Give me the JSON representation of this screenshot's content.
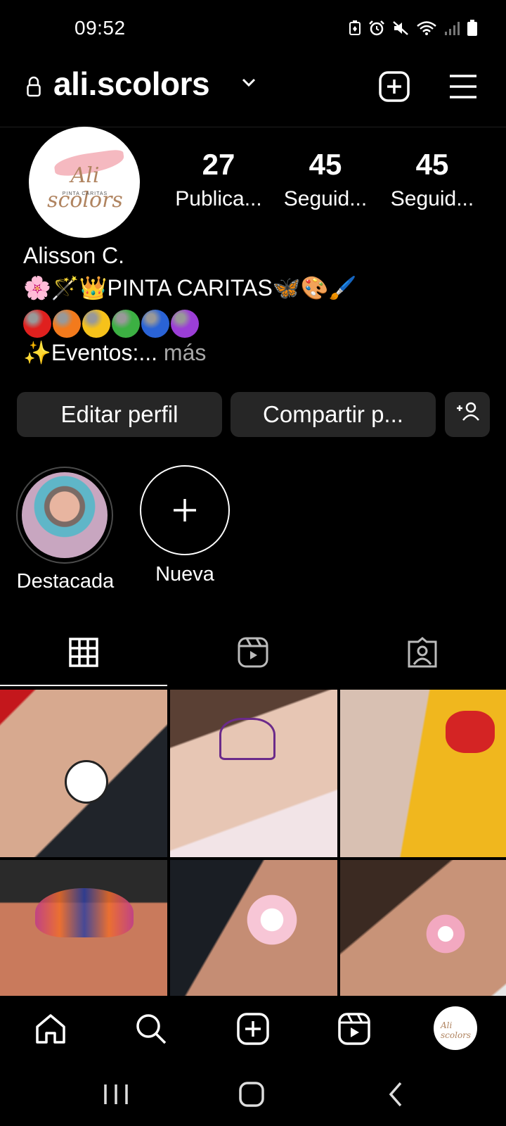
{
  "status": {
    "time": "09:52",
    "icons": [
      "battery-saver-icon",
      "alarm-icon",
      "mute-icon",
      "wifi-icon",
      "signal-icon",
      "battery-icon"
    ]
  },
  "header": {
    "username": "ali.scolors",
    "lock_icon": "lock-icon",
    "dropdown_icon": "chevron-down-icon",
    "create_icon": "plus-square-icon",
    "menu_icon": "hamburger-menu-icon"
  },
  "profile": {
    "avatar_text": "Ali scolors",
    "avatar_sub": "PINTA CARITAS",
    "stats": [
      {
        "value": "27",
        "label": "Publica..."
      },
      {
        "value": "45",
        "label": "Seguid..."
      },
      {
        "value": "45",
        "label": "Seguid..."
      }
    ],
    "name": "Alisson C.",
    "bio_line1": "🌸🪄👑PINTA CARITAS🦋🎨🖌️",
    "bio_circle_colors": [
      "#e0201e",
      "#f37a1c",
      "#f6c21a",
      "#3cb043",
      "#2a63d6",
      "#9b3ed6"
    ],
    "bio_line3": "✨Eventos:...",
    "more_label": " más"
  },
  "buttons": {
    "edit_profile": "Editar perfil",
    "share_profile": "Compartir p...",
    "discover_people_icon": "add-person-icon"
  },
  "highlights": [
    {
      "label": "Destacada"
    },
    {
      "label": "Nueva"
    }
  ],
  "tabs": [
    {
      "name": "grid",
      "icon": "grid-icon",
      "active": true
    },
    {
      "name": "reels",
      "icon": "reels-icon",
      "active": false
    },
    {
      "name": "tagged",
      "icon": "tagged-icon",
      "active": false
    }
  ],
  "bottom_nav": [
    "home-icon",
    "search-icon",
    "create-icon",
    "reels-icon",
    "profile-avatar"
  ],
  "system_nav": [
    "recents-icon",
    "home-button-icon",
    "back-icon"
  ]
}
